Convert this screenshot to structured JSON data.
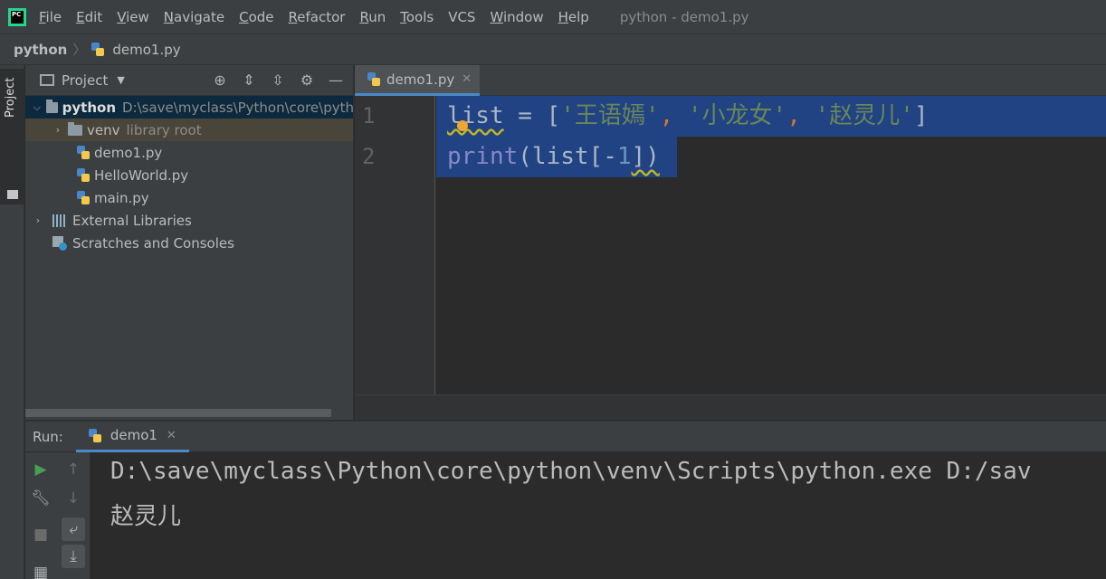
{
  "window": {
    "title": "python - demo1.py",
    "logo_text": "PC"
  },
  "menu": [
    {
      "label": "File",
      "mnemonic": "F",
      "rest": "ile"
    },
    {
      "label": "Edit",
      "mnemonic": "E",
      "rest": "dit"
    },
    {
      "label": "View",
      "mnemonic": "V",
      "rest": "iew"
    },
    {
      "label": "Navigate",
      "mnemonic": "N",
      "rest": "avigate"
    },
    {
      "label": "Code",
      "mnemonic": "C",
      "rest": "ode"
    },
    {
      "label": "Refactor",
      "mnemonic": "R",
      "rest": "efactor"
    },
    {
      "label": "Run",
      "mnemonic": "R",
      "rest": "un"
    },
    {
      "label": "Tools",
      "mnemonic": "T",
      "rest": "ools"
    },
    {
      "label": "VCS",
      "mnemonic": "",
      "rest": "VCS"
    },
    {
      "label": "Window",
      "mnemonic": "W",
      "rest": "indow"
    },
    {
      "label": "Help",
      "mnemonic": "H",
      "rest": "elp"
    }
  ],
  "breadcrumb": {
    "root": "python",
    "file": "demo1.py"
  },
  "left_stripe": {
    "project_tab": "Project"
  },
  "project_panel": {
    "title": "Project",
    "tools": [
      "locate-icon",
      "expand-all-icon",
      "collapse-all-icon",
      "gear-icon",
      "minimize-icon"
    ],
    "tree": [
      {
        "label": "python",
        "path": "D:\\save\\myclass\\Python\\core\\pyth",
        "kind": "folder",
        "expanded": true,
        "selected": true
      },
      {
        "label": "venv",
        "path": "library root",
        "kind": "folder",
        "expanded": false
      },
      {
        "label": "demo1.py",
        "kind": "python-file"
      },
      {
        "label": "HelloWorld.py",
        "kind": "python-file"
      },
      {
        "label": "main.py",
        "kind": "python-file"
      },
      {
        "label": "External Libraries",
        "kind": "library",
        "expanded": false
      },
      {
        "label": "Scratches and Consoles",
        "kind": "scratch"
      }
    ]
  },
  "editor": {
    "tab": "demo1.py",
    "line_numbers": [
      "1",
      "2"
    ],
    "lines": [
      {
        "tokens": [
          {
            "t": "list",
            "c": "plain"
          },
          {
            "t": " = ",
            "c": "plain"
          },
          {
            "t": "[",
            "c": "plain"
          },
          {
            "t": "'王语嫣'",
            "c": "str"
          },
          {
            "t": ", ",
            "c": "punct"
          },
          {
            "t": "'小龙女'",
            "c": "str"
          },
          {
            "t": ", ",
            "c": "punct"
          },
          {
            "t": "'赵灵儿'",
            "c": "str"
          },
          {
            "t": "]",
            "c": "plain"
          }
        ]
      },
      {
        "tokens": [
          {
            "t": "print",
            "c": "builtin"
          },
          {
            "t": "(list[-",
            "c": "plain"
          },
          {
            "t": "1",
            "c": "num"
          },
          {
            "t": "])",
            "c": "plain"
          }
        ]
      }
    ]
  },
  "run_panel": {
    "label": "Run:",
    "tab": "demo1",
    "output": [
      "D:\\save\\myclass\\Python\\core\\python\\venv\\Scripts\\python.exe D:/sav",
      "赵灵儿"
    ]
  },
  "colors": {
    "selection": "#214283",
    "accent": "#4a88c7",
    "string": "#6a8759",
    "builtin": "#8888c6",
    "run_green": "#499c54"
  }
}
